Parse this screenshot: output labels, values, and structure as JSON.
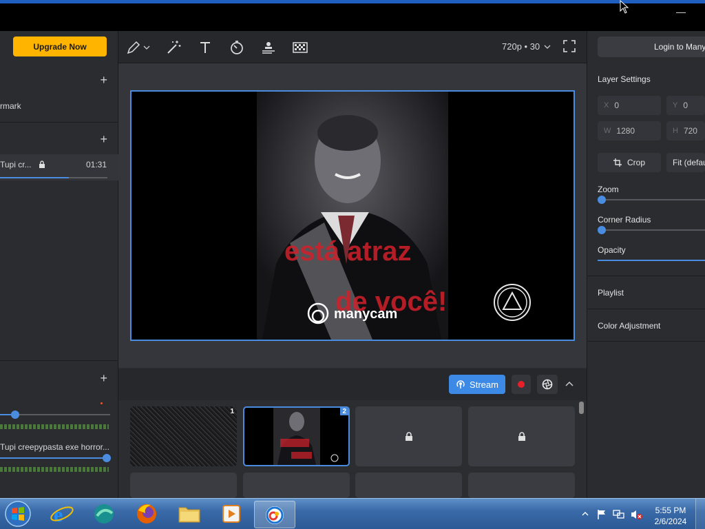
{
  "window": {
    "minimize_glyph": "—"
  },
  "header": {
    "upgrade_label": "Upgrade Now",
    "resolution": "720p • 30",
    "login_label": "Login to Many"
  },
  "left_panel": {
    "sections": [
      {
        "item": "rmark"
      },
      {
        "item": "Tupi cr...",
        "duration": "01:31",
        "locked": true
      },
      {
        "item": "Tupi creepypasta exe horror..."
      }
    ]
  },
  "toolbar": {
    "icons": [
      "pencil-icon",
      "magic-wand-icon",
      "text-icon",
      "timer-icon",
      "lower-third-icon",
      "chroma-key-icon"
    ]
  },
  "preview": {
    "overlay_text_1": "está atraz",
    "overlay_text_2": "de você!",
    "watermark": "manycam"
  },
  "controls": {
    "stream_label": "Stream"
  },
  "scenes": [
    {
      "number": "1",
      "type": "static"
    },
    {
      "number": "2",
      "type": "video",
      "active": true
    },
    {
      "locked": true
    },
    {
      "locked": true
    }
  ],
  "layer_settings": {
    "title": "Layer Settings",
    "x_key": "X",
    "x": "0",
    "y_key": "Y",
    "y": "0",
    "w_key": "W",
    "w": "1280",
    "h_key": "H",
    "h": "720",
    "crop_label": "Crop",
    "fit_label": "Fit (defau",
    "zoom_label": "Zoom",
    "zoom_value": 0,
    "corner_label": "Corner Radius",
    "corner_value": 0,
    "opacity_label": "Opacity",
    "opacity_value": 100
  },
  "right_sections": {
    "playlist": "Playlist",
    "color": "Color Adjustment"
  },
  "taskbar": {
    "time": "5:55 PM",
    "date": "2/6/2024"
  },
  "colors": {
    "accent": "#4a8de0",
    "upgrade": "#ffb400",
    "stream": "#3d8ae6",
    "record": "#e5202a"
  }
}
